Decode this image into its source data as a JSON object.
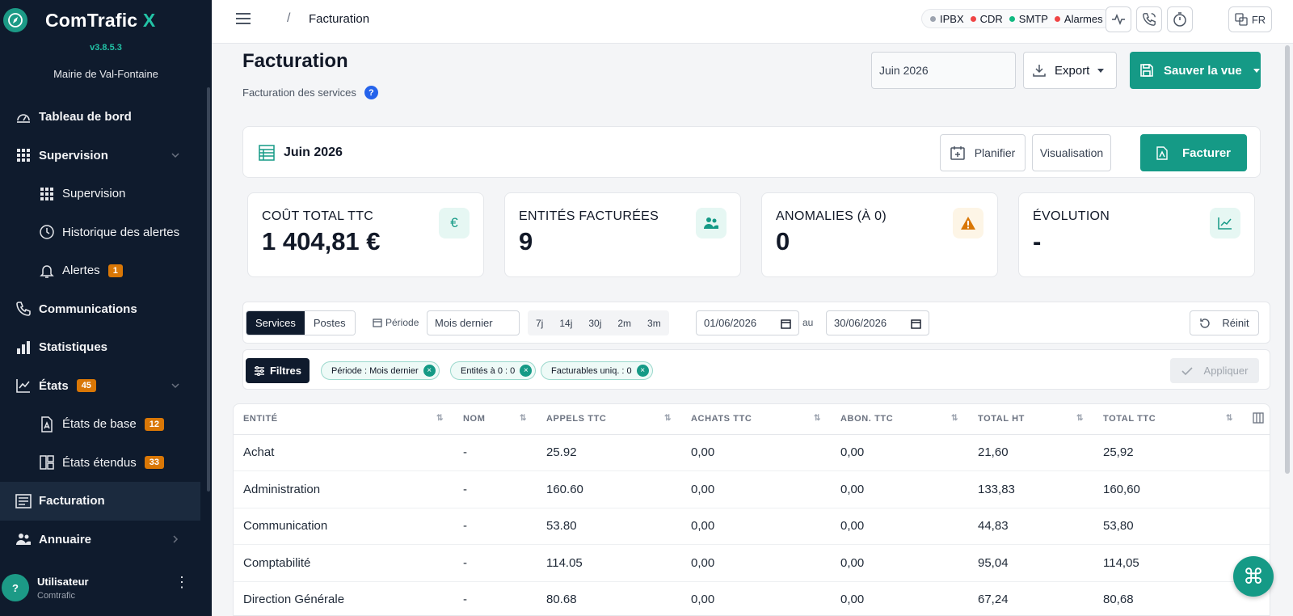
{
  "app": {
    "name_main": "ComTrafic",
    "name_accent": "X",
    "version": "v3.8.5.3",
    "org": "Mairie de Val-Fontaine"
  },
  "sidebar": {
    "items": [
      {
        "label": "Tableau de bord",
        "icon": "gauge-icon"
      },
      {
        "label": "Supervision",
        "icon": "grid-icon"
      },
      {
        "label": "Supervision",
        "icon": "grid-icon"
      },
      {
        "label": "Historique des alertes",
        "icon": "history-icon"
      },
      {
        "label": "Alertes",
        "icon": "bell-icon",
        "badge": "1"
      },
      {
        "label": "Communications",
        "icon": "phone-icon"
      },
      {
        "label": "Statistiques",
        "icon": "bar-chart-icon"
      },
      {
        "label": "États",
        "icon": "line-chart-icon",
        "badge": "45"
      },
      {
        "label": "États de base",
        "icon": "pdf-icon",
        "badge": "12"
      },
      {
        "label": "États étendus",
        "icon": "layout-icon",
        "badge": "33"
      },
      {
        "label": "Facturation",
        "icon": "invoice-icon"
      },
      {
        "label": "Annuaire",
        "icon": "people-icon"
      }
    ]
  },
  "user": {
    "avatar": "?",
    "name": "Utilisateur",
    "role": "Comtrafic"
  },
  "topbar": {
    "breadcrumb_sep": "/",
    "breadcrumb": "Facturation",
    "status": [
      {
        "label": "IPBX",
        "color": "#9ca3af"
      },
      {
        "label": "CDR",
        "color": "#ef4444"
      },
      {
        "label": "SMTP",
        "color": "#10b981"
      },
      {
        "label": "Alarmes",
        "color": "#ef4444"
      }
    ],
    "lang": "FR"
  },
  "page": {
    "title": "Facturation",
    "subtitle": "Facturation des services",
    "help": "?",
    "month_value": "Juin 2026",
    "export_label": "Export",
    "save_label": "Sauver la vue"
  },
  "billing": {
    "period": "Juin 2026",
    "planifier": "Planifier",
    "visualisation": "Visualisation",
    "facturer": "Facturer"
  },
  "kpis": [
    {
      "label": "COÛT TOTAL TTC",
      "value": "1 404,81 €",
      "icon": "€"
    },
    {
      "label": "ENTITÉS FACTURÉES",
      "value": "9"
    },
    {
      "label": "ANOMALIES (À 0)",
      "value": "0"
    },
    {
      "label": "ÉVOLUTION",
      "value": "-"
    }
  ],
  "filters": {
    "tabs": [
      "Services",
      "Postes"
    ],
    "period_label": "Période",
    "period_value": "Mois dernier",
    "quick": [
      "7j",
      "14j",
      "30j",
      "2m",
      "3m"
    ],
    "date_from": "01/06/2026",
    "date_sep": "au",
    "date_to": "30/06/2026",
    "reset": "Réinit",
    "filtres": "Filtres",
    "chips": [
      "Période : Mois dernier",
      "Entités à 0 : 0",
      "Facturables uniq. : 0"
    ],
    "chip_close": "×",
    "apply": "Appliquer"
  },
  "table": {
    "sort_glyph": "⇅",
    "columns": [
      "ENTITÉ",
      "NOM",
      "APPELS TTC",
      "ACHATS TTC",
      "ABON. TTC",
      "TOTAL HT",
      "TOTAL TTC"
    ],
    "rows": [
      [
        "Achat",
        "-",
        "25.92",
        "0,00",
        "0,00",
        "21,60",
        "25,92"
      ],
      [
        "Administration",
        "-",
        "160.60",
        "0,00",
        "0,00",
        "133,83",
        "160,60"
      ],
      [
        "Communication",
        "-",
        "53.80",
        "0,00",
        "0,00",
        "44,83",
        "53,80"
      ],
      [
        "Comptabilité",
        "-",
        "114.05",
        "0,00",
        "0,00",
        "95,04",
        "114,05"
      ],
      [
        "Direction Générale",
        "-",
        "80.68",
        "0,00",
        "0,00",
        "67,24",
        "80,68"
      ]
    ]
  },
  "fab": {
    "icon": "command-icon",
    "glyph": "⌘"
  }
}
